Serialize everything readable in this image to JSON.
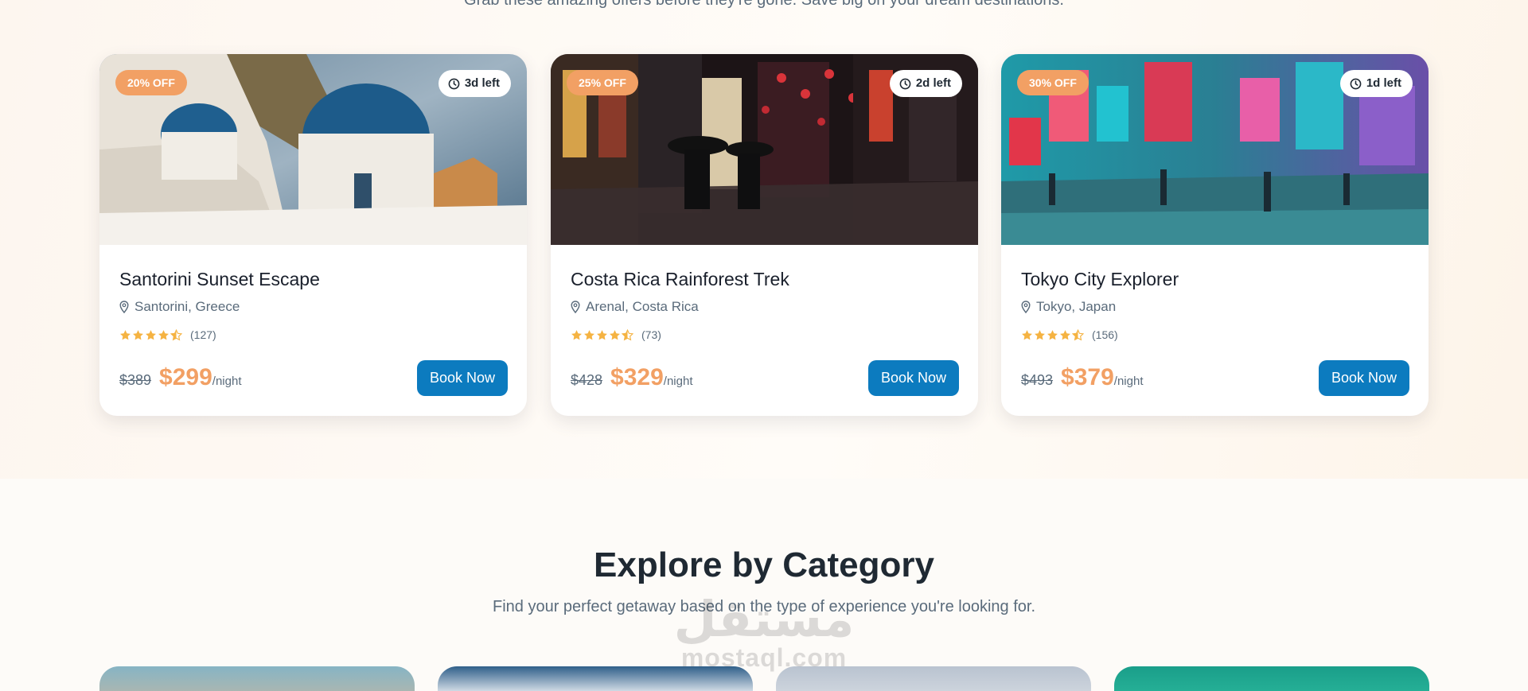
{
  "deals": {
    "subtitle": "Grab these amazing offers before they're gone. Save big on your dream destinations."
  },
  "cards": [
    {
      "discount": "20% OFF",
      "time_left": "3d left",
      "title": "Santorini Sunset Escape",
      "location": "Santorini, Greece",
      "rating_count": "(127)",
      "rating": 4.5,
      "old_price": "$389",
      "new_price": "$299",
      "per": "/night",
      "cta": "Book Now"
    },
    {
      "discount": "25% OFF",
      "time_left": "2d left",
      "title": "Costa Rica Rainforest Trek",
      "location": "Arenal, Costa Rica",
      "rating_count": "(73)",
      "rating": 4.5,
      "old_price": "$428",
      "new_price": "$329",
      "per": "/night",
      "cta": "Book Now"
    },
    {
      "discount": "30% OFF",
      "time_left": "1d left",
      "title": "Tokyo City Explorer",
      "location": "Tokyo, Japan",
      "rating_count": "(156)",
      "rating": 4.5,
      "old_price": "$493",
      "new_price": "$379",
      "per": "/night",
      "cta": "Book Now"
    }
  ],
  "category": {
    "title": "Explore by Category",
    "subtitle": "Find your perfect getaway based on the type of experience you're looking for."
  },
  "watermark": {
    "arabic": "مستقل",
    "latin": "mostaql.com"
  },
  "icons": {
    "clock": "clock-icon",
    "location": "map-pin-icon",
    "star": "star-icon"
  },
  "colors": {
    "accent": "#f2a064",
    "primary": "#0c7bbf",
    "star": "#f5b342"
  }
}
